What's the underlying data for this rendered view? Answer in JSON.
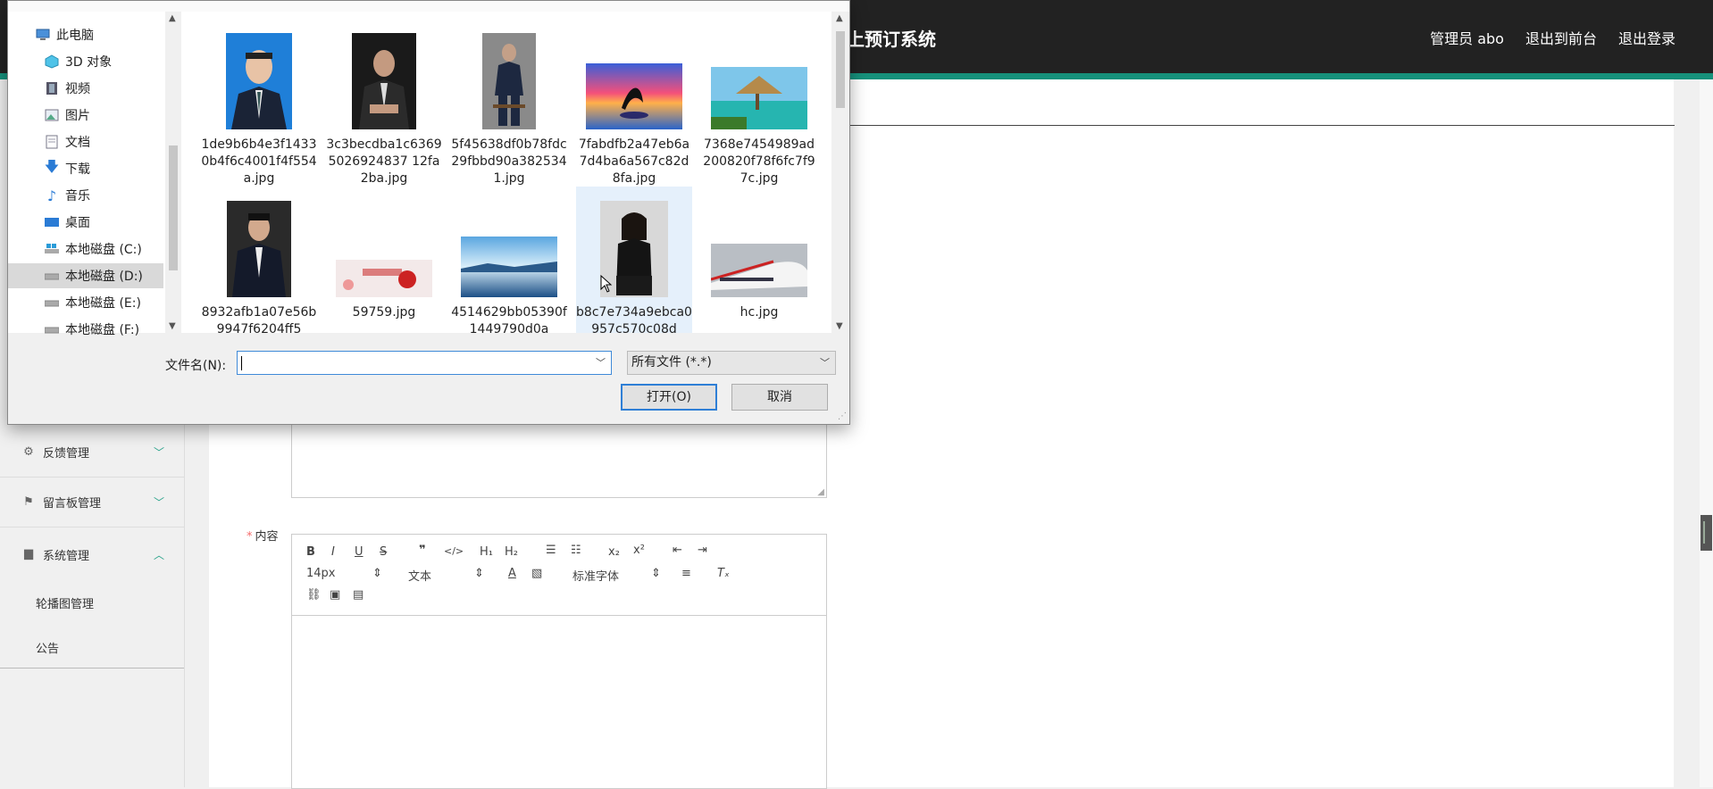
{
  "app": {
    "title": "上预订系统",
    "header_links": [
      "管理员 abo",
      "退出到前台",
      "退出登录"
    ],
    "accent_color": "#16917b"
  },
  "sidebar": {
    "groups": [
      {
        "label": "反馈管理",
        "icon": "sliders-icon",
        "expanded": false
      },
      {
        "label": "留言板管理",
        "icon": "flag-icon",
        "expanded": false
      },
      {
        "label": "系统管理",
        "icon": "briefcase-icon",
        "expanded": true
      }
    ],
    "subitems": [
      "轮播图管理",
      "公告"
    ]
  },
  "form": {
    "content_label": "内容",
    "editor": {
      "font_size": "14px",
      "text_type": "文本",
      "font_family": "标准字体"
    }
  },
  "dialog": {
    "nav_items": [
      {
        "label": "此电脑",
        "icon": "computer-icon"
      },
      {
        "label": "3D 对象",
        "icon": "cube-icon"
      },
      {
        "label": "视频",
        "icon": "film-icon"
      },
      {
        "label": "图片",
        "icon": "picture-icon"
      },
      {
        "label": "文档",
        "icon": "document-icon"
      },
      {
        "label": "下载",
        "icon": "download-icon"
      },
      {
        "label": "音乐",
        "icon": "music-icon"
      },
      {
        "label": "桌面",
        "icon": "desktop-icon"
      },
      {
        "label": "本地磁盘 (C:)",
        "icon": "windows-drive-icon"
      },
      {
        "label": "本地磁盘 (D:)",
        "icon": "drive-icon",
        "selected": true
      },
      {
        "label": "本地磁盘 (E:)",
        "icon": "drive-icon"
      },
      {
        "label": "本地磁盘 (F:)",
        "icon": "drive-icon"
      }
    ],
    "files": [
      {
        "name": "1de9b6b4e3f14330b4f6c4001f4f554a.jpg",
        "thumb": "portrait-blue"
      },
      {
        "name": "3c3becdba1c63695026924837 12fa2ba.jpg",
        "thumb": "portrait-dark"
      },
      {
        "name": "5f45638df0b78fdc29fbbd90a3825341.jpg",
        "thumb": "portrait-grey"
      },
      {
        "name": "7fabdfb2a47eb6a7d4ba6a567c82d8fa.jpg",
        "thumb": "sunset-dolphin"
      },
      {
        "name": "7368e7454989ad200820f78f6fc7f97c.jpg",
        "thumb": "beach"
      },
      {
        "name": "8932afb1a07e56b9947f6204ff5",
        "thumb": "portrait-man"
      },
      {
        "name": "59759.jpg",
        "thumb": "banner-red"
      },
      {
        "name": "4514629bb05390f1449790d0a",
        "thumb": "lake"
      },
      {
        "name": "b8c7e734a9ebca0957c570c08d",
        "thumb": "portrait-woman",
        "selected": true
      },
      {
        "name": "hc.jpg",
        "thumb": "train"
      }
    ],
    "filename_label": "文件名(N):",
    "filename_value": "",
    "filter": "所有文件 (*.*)",
    "open_button": "打开(O)",
    "cancel_button": "取消"
  }
}
